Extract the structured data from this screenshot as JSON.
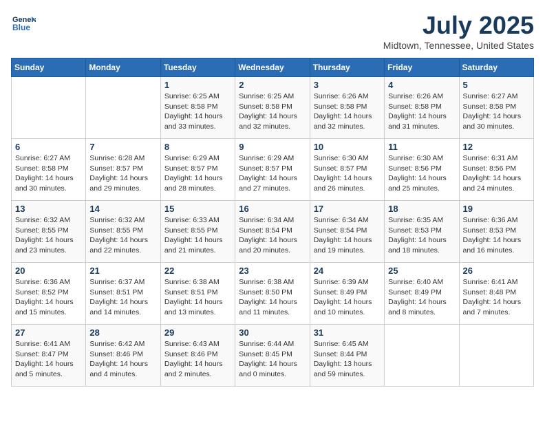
{
  "header": {
    "logo": {
      "line1": "General",
      "line2": "Blue"
    },
    "title": "July 2025",
    "location": "Midtown, Tennessee, United States"
  },
  "weekdays": [
    "Sunday",
    "Monday",
    "Tuesday",
    "Wednesday",
    "Thursday",
    "Friday",
    "Saturday"
  ],
  "weeks": [
    [
      {
        "day": "",
        "info": ""
      },
      {
        "day": "",
        "info": ""
      },
      {
        "day": "1",
        "info": "Sunrise: 6:25 AM\nSunset: 8:58 PM\nDaylight: 14 hours and 33 minutes."
      },
      {
        "day": "2",
        "info": "Sunrise: 6:25 AM\nSunset: 8:58 PM\nDaylight: 14 hours and 32 minutes."
      },
      {
        "day": "3",
        "info": "Sunrise: 6:26 AM\nSunset: 8:58 PM\nDaylight: 14 hours and 32 minutes."
      },
      {
        "day": "4",
        "info": "Sunrise: 6:26 AM\nSunset: 8:58 PM\nDaylight: 14 hours and 31 minutes."
      },
      {
        "day": "5",
        "info": "Sunrise: 6:27 AM\nSunset: 8:58 PM\nDaylight: 14 hours and 30 minutes."
      }
    ],
    [
      {
        "day": "6",
        "info": "Sunrise: 6:27 AM\nSunset: 8:58 PM\nDaylight: 14 hours and 30 minutes."
      },
      {
        "day": "7",
        "info": "Sunrise: 6:28 AM\nSunset: 8:57 PM\nDaylight: 14 hours and 29 minutes."
      },
      {
        "day": "8",
        "info": "Sunrise: 6:29 AM\nSunset: 8:57 PM\nDaylight: 14 hours and 28 minutes."
      },
      {
        "day": "9",
        "info": "Sunrise: 6:29 AM\nSunset: 8:57 PM\nDaylight: 14 hours and 27 minutes."
      },
      {
        "day": "10",
        "info": "Sunrise: 6:30 AM\nSunset: 8:57 PM\nDaylight: 14 hours and 26 minutes."
      },
      {
        "day": "11",
        "info": "Sunrise: 6:30 AM\nSunset: 8:56 PM\nDaylight: 14 hours and 25 minutes."
      },
      {
        "day": "12",
        "info": "Sunrise: 6:31 AM\nSunset: 8:56 PM\nDaylight: 14 hours and 24 minutes."
      }
    ],
    [
      {
        "day": "13",
        "info": "Sunrise: 6:32 AM\nSunset: 8:55 PM\nDaylight: 14 hours and 23 minutes."
      },
      {
        "day": "14",
        "info": "Sunrise: 6:32 AM\nSunset: 8:55 PM\nDaylight: 14 hours and 22 minutes."
      },
      {
        "day": "15",
        "info": "Sunrise: 6:33 AM\nSunset: 8:55 PM\nDaylight: 14 hours and 21 minutes."
      },
      {
        "day": "16",
        "info": "Sunrise: 6:34 AM\nSunset: 8:54 PM\nDaylight: 14 hours and 20 minutes."
      },
      {
        "day": "17",
        "info": "Sunrise: 6:34 AM\nSunset: 8:54 PM\nDaylight: 14 hours and 19 minutes."
      },
      {
        "day": "18",
        "info": "Sunrise: 6:35 AM\nSunset: 8:53 PM\nDaylight: 14 hours and 18 minutes."
      },
      {
        "day": "19",
        "info": "Sunrise: 6:36 AM\nSunset: 8:53 PM\nDaylight: 14 hours and 16 minutes."
      }
    ],
    [
      {
        "day": "20",
        "info": "Sunrise: 6:36 AM\nSunset: 8:52 PM\nDaylight: 14 hours and 15 minutes."
      },
      {
        "day": "21",
        "info": "Sunrise: 6:37 AM\nSunset: 8:51 PM\nDaylight: 14 hours and 14 minutes."
      },
      {
        "day": "22",
        "info": "Sunrise: 6:38 AM\nSunset: 8:51 PM\nDaylight: 14 hours and 13 minutes."
      },
      {
        "day": "23",
        "info": "Sunrise: 6:38 AM\nSunset: 8:50 PM\nDaylight: 14 hours and 11 minutes."
      },
      {
        "day": "24",
        "info": "Sunrise: 6:39 AM\nSunset: 8:49 PM\nDaylight: 14 hours and 10 minutes."
      },
      {
        "day": "25",
        "info": "Sunrise: 6:40 AM\nSunset: 8:49 PM\nDaylight: 14 hours and 8 minutes."
      },
      {
        "day": "26",
        "info": "Sunrise: 6:41 AM\nSunset: 8:48 PM\nDaylight: 14 hours and 7 minutes."
      }
    ],
    [
      {
        "day": "27",
        "info": "Sunrise: 6:41 AM\nSunset: 8:47 PM\nDaylight: 14 hours and 5 minutes."
      },
      {
        "day": "28",
        "info": "Sunrise: 6:42 AM\nSunset: 8:46 PM\nDaylight: 14 hours and 4 minutes."
      },
      {
        "day": "29",
        "info": "Sunrise: 6:43 AM\nSunset: 8:46 PM\nDaylight: 14 hours and 2 minutes."
      },
      {
        "day": "30",
        "info": "Sunrise: 6:44 AM\nSunset: 8:45 PM\nDaylight: 14 hours and 0 minutes."
      },
      {
        "day": "31",
        "info": "Sunrise: 6:45 AM\nSunset: 8:44 PM\nDaylight: 13 hours and 59 minutes."
      },
      {
        "day": "",
        "info": ""
      },
      {
        "day": "",
        "info": ""
      }
    ]
  ]
}
